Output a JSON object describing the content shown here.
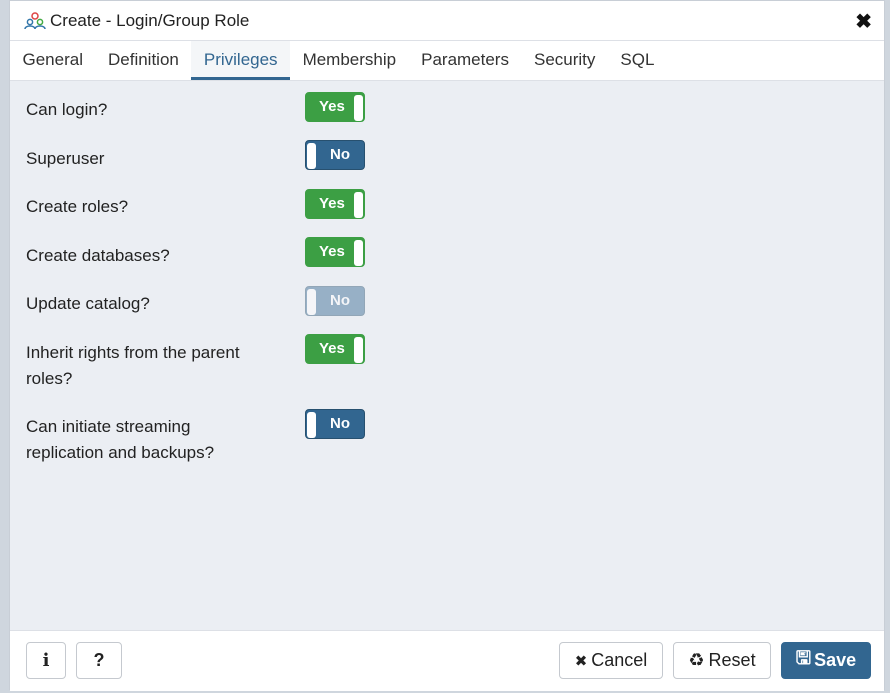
{
  "dialog": {
    "title": "Create - Login/Group Role",
    "icon": "group-role-icon"
  },
  "tabs": [
    {
      "label": "General"
    },
    {
      "label": "Definition"
    },
    {
      "label": "Privileges",
      "active": true
    },
    {
      "label": "Membership"
    },
    {
      "label": "Parameters"
    },
    {
      "label": "Security"
    },
    {
      "label": "SQL"
    }
  ],
  "privileges": [
    {
      "label": "Can login?",
      "value": "Yes",
      "on": true
    },
    {
      "label": "Superuser",
      "value": "No",
      "on": false
    },
    {
      "label": "Create roles?",
      "value": "Yes",
      "on": true
    },
    {
      "label": "Create databases?",
      "value": "Yes",
      "on": true
    },
    {
      "label": "Update catalog?",
      "value": "No",
      "on": false,
      "disabled": true
    },
    {
      "label": "Inherit rights from the parent roles?",
      "value": "Yes",
      "on": true
    },
    {
      "label": "Can initiate streaming replication and backups?",
      "value": "No",
      "on": false
    }
  ],
  "footer": {
    "info": "i",
    "help": "?",
    "cancel": "Cancel",
    "reset": "Reset",
    "save": "Save"
  },
  "colors": {
    "on": "#3c9f44",
    "off": "#326690",
    "primary": "#326690"
  }
}
